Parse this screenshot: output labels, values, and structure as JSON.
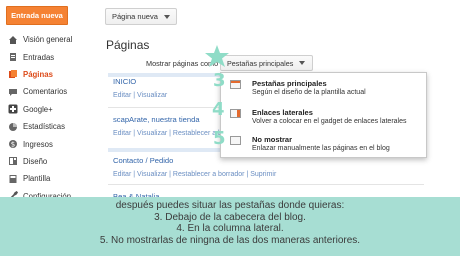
{
  "top": {
    "new_post_button": "Entrada nueva",
    "new_page_button": "Página nueva"
  },
  "sidebar": {
    "items": [
      {
        "label": "Visión general",
        "icon": "home-icon",
        "active": false
      },
      {
        "label": "Entradas",
        "icon": "document-icon",
        "active": false
      },
      {
        "label": "Páginas",
        "icon": "pages-icon",
        "active": true
      },
      {
        "label": "Comentarios",
        "icon": "comment-icon",
        "active": false
      },
      {
        "label": "Google+",
        "icon": "google-plus-icon",
        "active": false
      },
      {
        "label": "Estadísticas",
        "icon": "stats-icon",
        "active": false
      },
      {
        "label": "Ingresos",
        "icon": "money-icon",
        "active": false
      },
      {
        "label": "Diseño",
        "icon": "layout-icon",
        "active": false
      },
      {
        "label": "Plantilla",
        "icon": "template-icon",
        "active": false
      },
      {
        "label": "Configuración",
        "icon": "wrench-icon",
        "active": false
      }
    ]
  },
  "main": {
    "title": "Páginas",
    "show_pages_label": "Mostrar páginas como",
    "display_select": "Pestañas principales",
    "pages": [
      {
        "title": "INICIO",
        "links": "Editar | Visualizar"
      },
      {
        "title": "scapArate, nuestra tienda",
        "links": "Editar | Visualizar | Restablecer a borrador"
      },
      {
        "title": "Contacto / Pedido",
        "links": "Editar | Visualizar | Restablecer a borrador | Suprimir"
      },
      {
        "title": "Bea & Natalia",
        "links": ""
      }
    ]
  },
  "dropdown": {
    "options": [
      {
        "title": "Pestañas principales",
        "desc": "Según el diseño de la plantilla actual"
      },
      {
        "title": "Enlaces laterales",
        "desc": "Volver a colocar en el gadget de enlaces laterales"
      },
      {
        "title": "No mostrar",
        "desc": "Enlazar manualmente las páginas en el blog"
      }
    ]
  },
  "annotations": {
    "numbers": [
      "3",
      "4",
      "5"
    ]
  },
  "caption": {
    "lines": [
      "después puedes situar las pestañas donde quieras:",
      "3. Debajo de la cabecera del blog.",
      "4. En la columna lateral.",
      "5. No mostrarlas de ningna de las dos maneras anteriores."
    ]
  },
  "colors": {
    "accent_orange": "#f58233",
    "link_blue": "#3466aa",
    "caption_bg": "#a7ded3",
    "annotation_mint": "#8fdcc7"
  }
}
